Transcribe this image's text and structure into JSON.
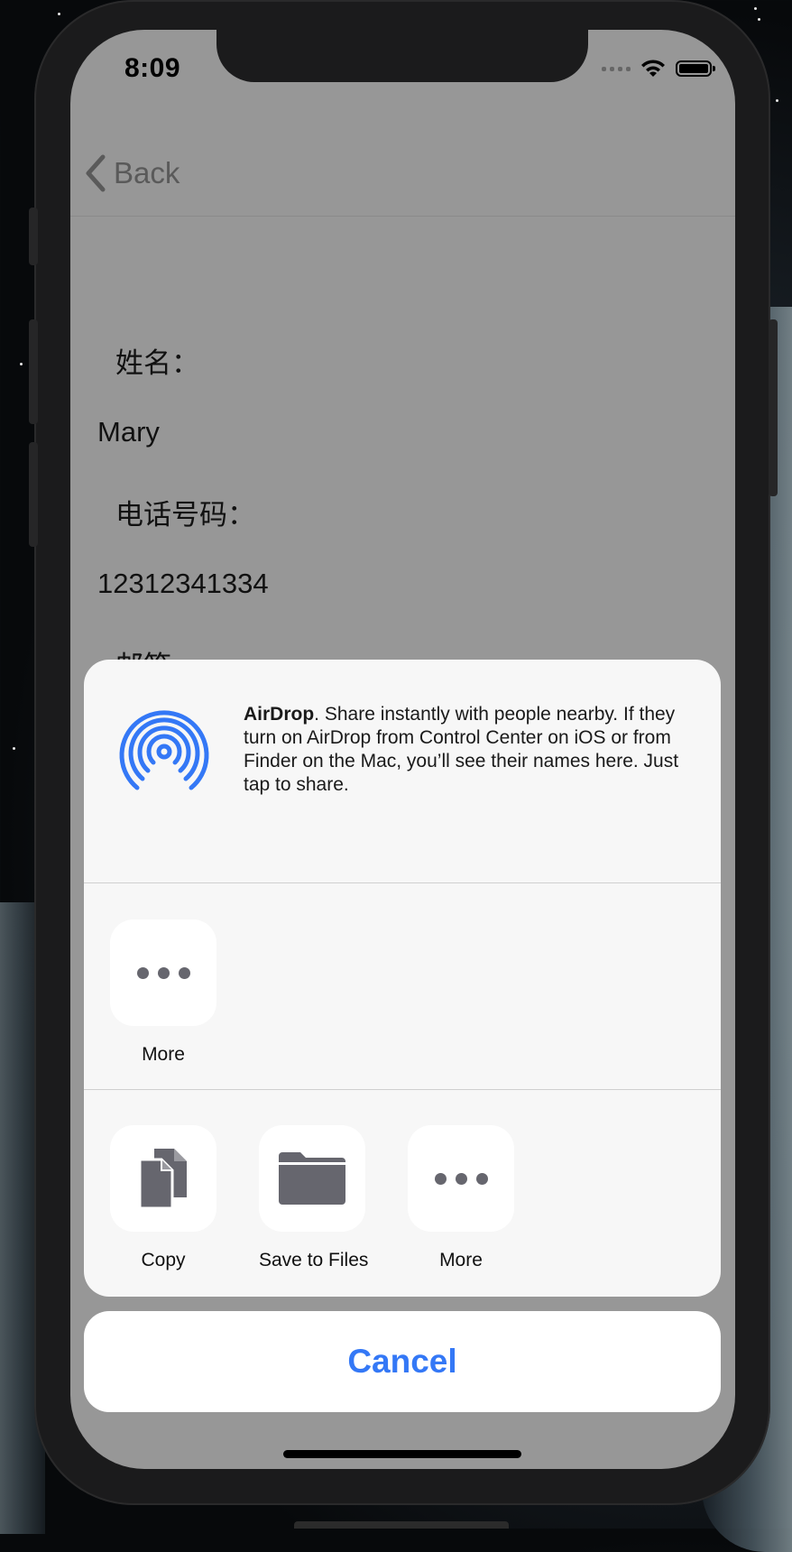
{
  "status_bar": {
    "time": "8:09"
  },
  "nav": {
    "back_label": "Back"
  },
  "content": {
    "name_label": "姓名：",
    "name_value": "Mary",
    "phone_label": "电话号码：",
    "phone_value": "12312341334",
    "email_label_partial": "邮箱"
  },
  "share_sheet": {
    "airdrop": {
      "title": "AirDrop",
      "description": ". Share instantly with people nearby. If they turn on AirDrop from Control Center on iOS or from Finder on the Mac, you’ll see their names here. Just tap to share."
    },
    "share_row": [
      {
        "label": "More",
        "icon": "more-dots-icon"
      }
    ],
    "action_row": [
      {
        "label": "Copy",
        "icon": "copy-icon"
      },
      {
        "label": "Save to Files",
        "icon": "folder-icon"
      },
      {
        "label": "More",
        "icon": "more-dots-icon"
      }
    ],
    "cancel_label": "Cancel"
  },
  "colors": {
    "accent": "#3478f6",
    "dimmed_background": "#979797",
    "sheet_background": "#f7f7f7",
    "icon_gray": "#66666e"
  }
}
